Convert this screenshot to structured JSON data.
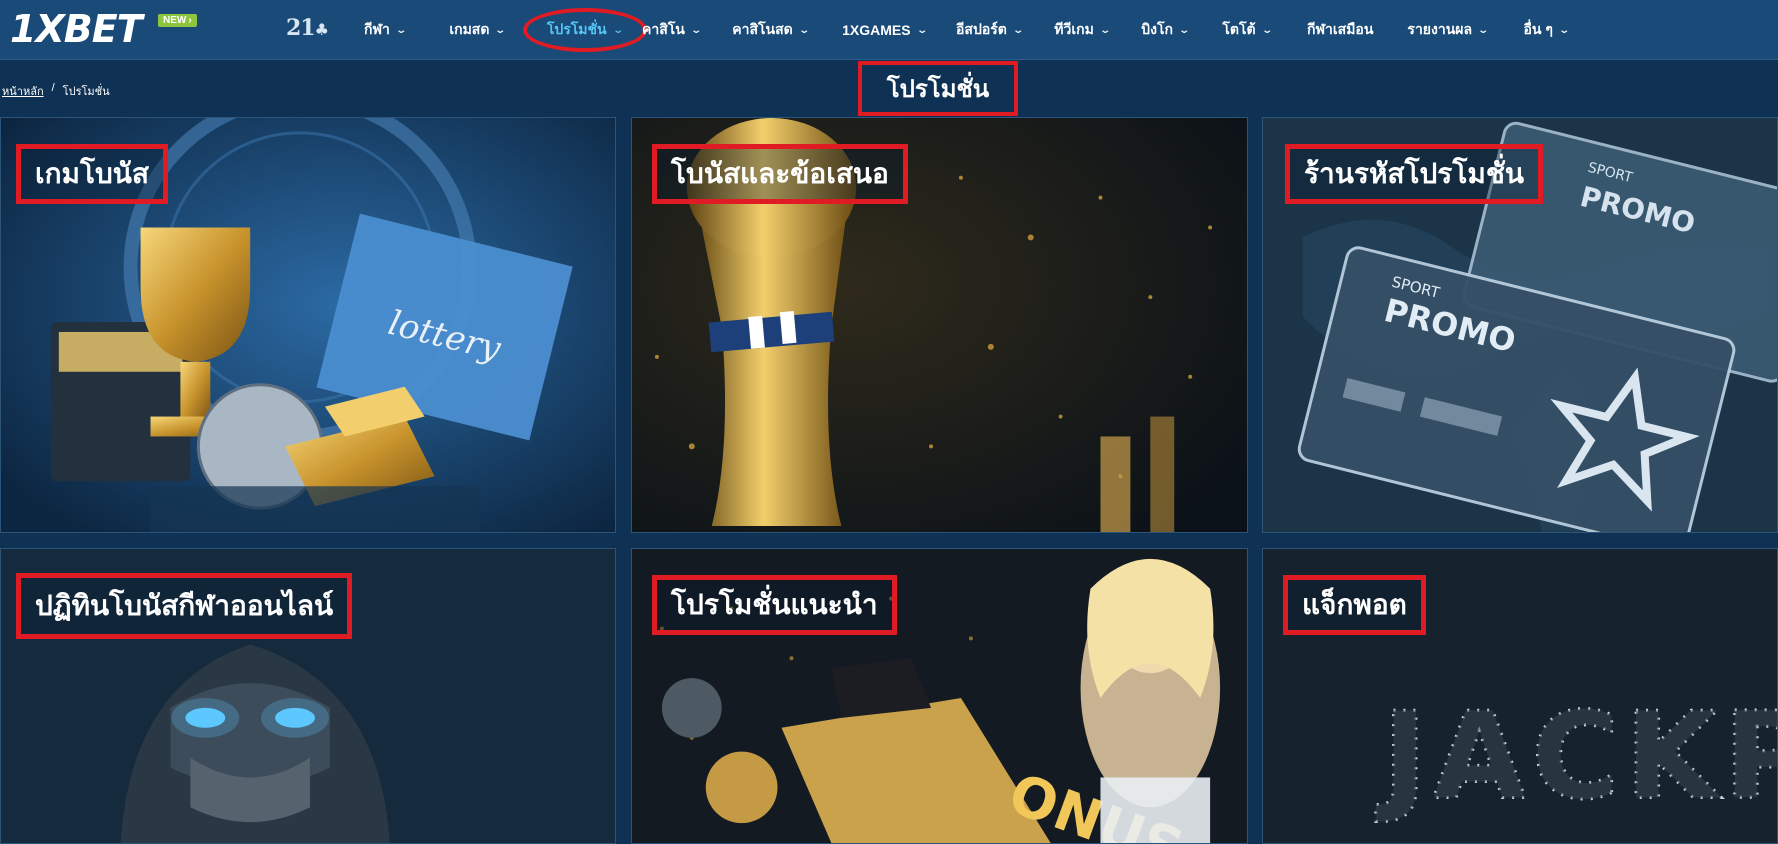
{
  "brand": {
    "logo": "1XBET",
    "new_badge": "NEW",
    "age_badge": "21"
  },
  "nav": {
    "items": [
      {
        "label": "กีฬา"
      },
      {
        "label": "เกมสด"
      },
      {
        "label": "โปรโมชั่น"
      },
      {
        "label": "คาสิโน"
      },
      {
        "label": "คาสิโนสด"
      },
      {
        "label": "1XGAMES"
      },
      {
        "label": "อีสปอร์ต"
      },
      {
        "label": "ทีวีเกม"
      },
      {
        "label": "บิงโก"
      },
      {
        "label": "โตโต้"
      },
      {
        "label": "กีฬาเสมือน"
      },
      {
        "label": "รายงานผล"
      },
      {
        "label": "อื่น ๆ"
      }
    ]
  },
  "breadcrumb": {
    "home": "หน้าหลัก",
    "separator": "/",
    "current": "โปรโมชั่น"
  },
  "page_title": "โปรโมชั่น",
  "cards": [
    {
      "label": "เกมโบนัส",
      "art_text": "lottery"
    },
    {
      "label": "โบนัสและข้อเสนอ"
    },
    {
      "label": "ร้านรหัสโปรโมชั่น",
      "art_text": "PROMO",
      "art_text2": "SPORT"
    },
    {
      "label": "ปฏิทินโบนัสกีฬาออนไลน์"
    },
    {
      "label": "โปรโมชั่นแนะนำ",
      "art_text": "ONUS"
    },
    {
      "label": "แจ็กพอต",
      "art_text": "JACKPOT"
    }
  ],
  "colors": {
    "header": "#1a4a78",
    "page": "#0f3153",
    "accent": "#57c6f5",
    "highlight": "#e01b24",
    "badge": "#8cc63f"
  }
}
